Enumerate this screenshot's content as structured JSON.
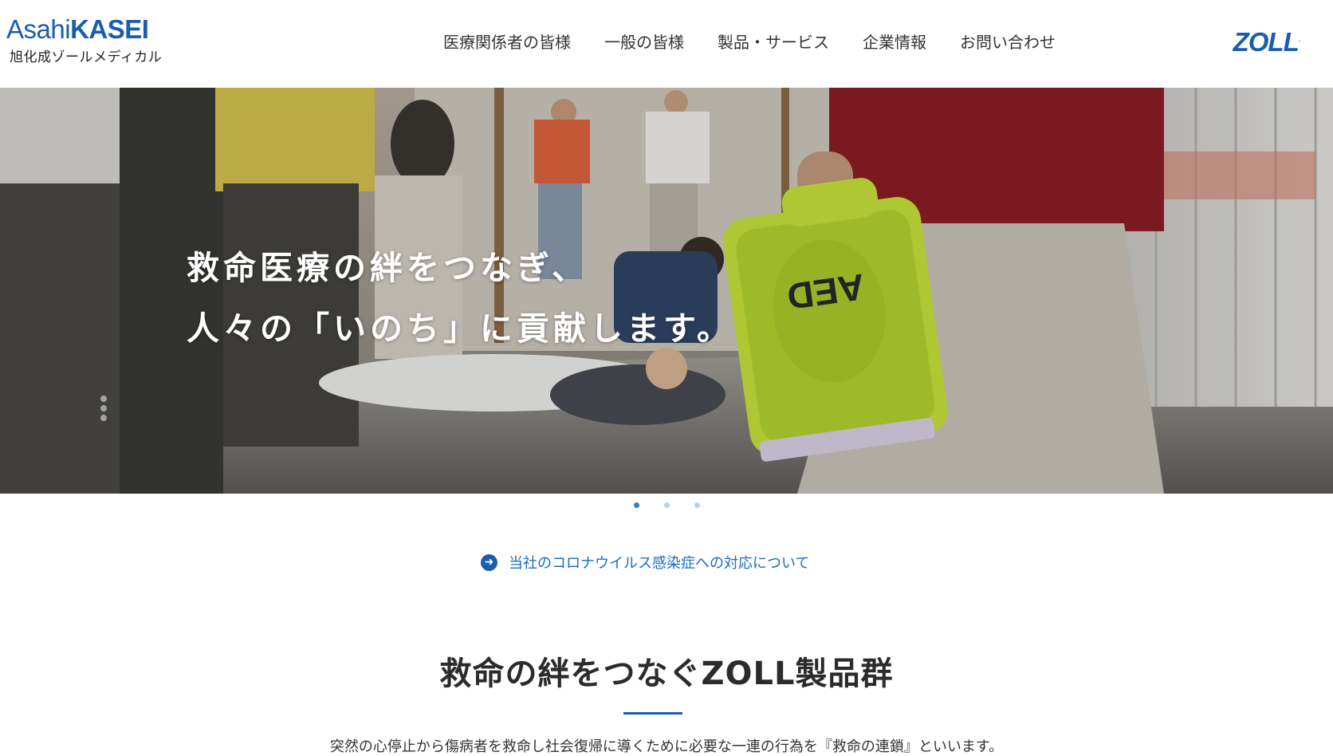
{
  "header": {
    "logo_prefix": "Asahi",
    "logo_bold": "KASEI",
    "logo_sub": "旭化成ゾールメディカル",
    "nav": [
      {
        "label": "医療関係者の皆様"
      },
      {
        "label": "一般の皆様"
      },
      {
        "label": "製品・サービス"
      },
      {
        "label": "企業情報"
      },
      {
        "label": "お問い合わせ"
      }
    ],
    "partner_logo": "ZOLL"
  },
  "hero": {
    "line1": "救命医療の絆をつなぎ、",
    "line2": "人々の「いのち」に貢献します。",
    "device_label": "AED",
    "slides_total": 3,
    "active_slide": 1
  },
  "notice": {
    "icon": "arrow-right-circle-icon",
    "text": "当社のコロナウイルス感染症への対応について"
  },
  "section": {
    "title": "救命の絆をつなぐZOLL製品群",
    "description": "突然の心停止から傷病者を救命し社会復帰に導くために必要な一連の行為を『救命の連鎖』といいます。"
  },
  "colors": {
    "brand_blue": "#1a5dab",
    "link_blue": "#1a6bc2",
    "aed_green": "#c6e33b",
    "dot_inactive": "#b7d0ea"
  }
}
